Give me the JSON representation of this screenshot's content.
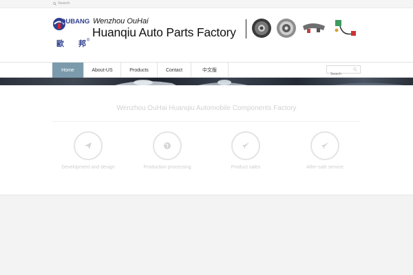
{
  "topbar": {
    "search_label": "Search",
    "search_icon": "search-icon"
  },
  "header": {
    "logo_text": "OUBANG",
    "logo_cn_1": "歐",
    "logo_cn_2": "邦",
    "logo_reg": "®",
    "brand_line1": "Wenzhou OuHai",
    "brand_line2": "Huanqiu Auto Parts Factory"
  },
  "nav": {
    "items": [
      {
        "label": "Home",
        "active": true
      },
      {
        "label": "About-US",
        "active": false
      },
      {
        "label": "Products",
        "active": false
      },
      {
        "label": "Contact",
        "active": false
      },
      {
        "label": "中文版",
        "active": false
      }
    ],
    "search_placeholder": "Search",
    "active_color": "#7b9bac"
  },
  "main": {
    "title": "Wenzhou OuHai Huanqiu Automobile Components Factory",
    "features": [
      {
        "label": "Development and design",
        "icon": "paper-plane-icon"
      },
      {
        "label": "Production processing",
        "icon": "globe-icon"
      },
      {
        "label": "Product sales",
        "icon": "rocket-icon"
      },
      {
        "label": "After-sale service",
        "icon": "rocket-icon"
      }
    ]
  }
}
